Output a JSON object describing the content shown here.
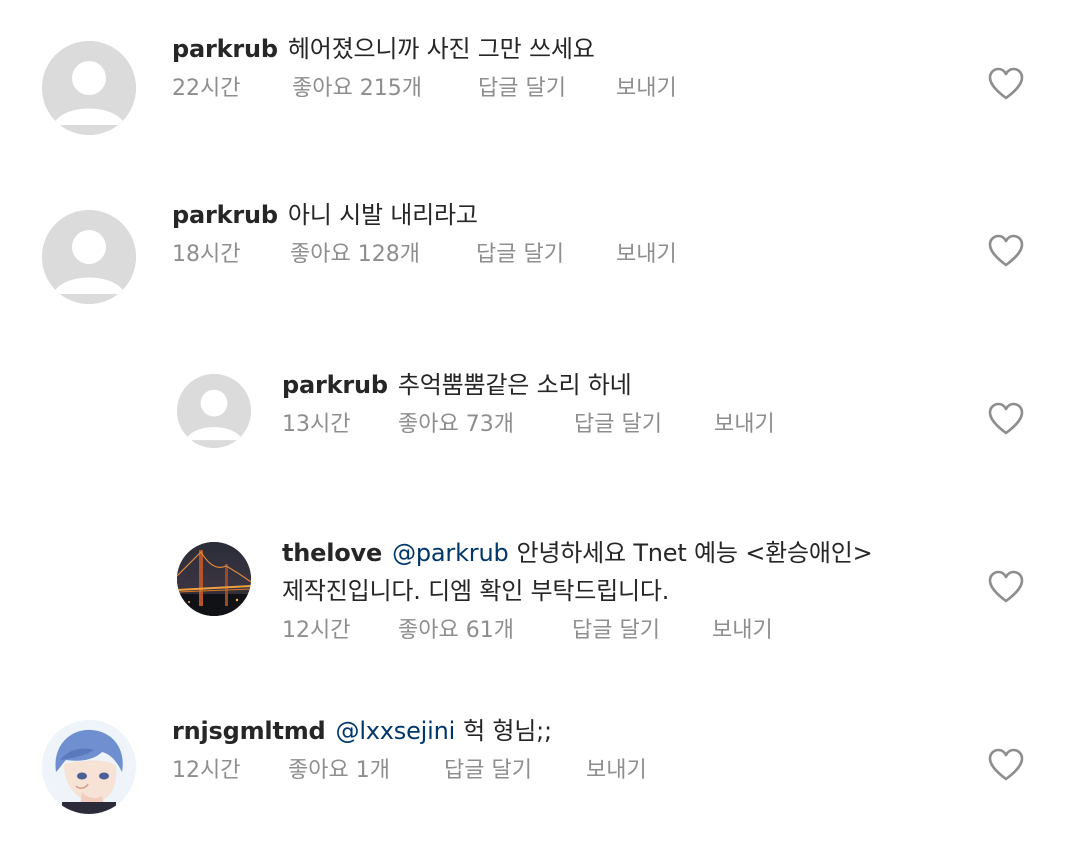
{
  "comments": [
    {
      "username": "parkrub",
      "mention": "",
      "text": "헤어졌으니까 사진 그만 쓰세요",
      "text2": "",
      "time": "22시간",
      "likes": "좋아요 215개",
      "reply_label": "답글 달기",
      "send_label": "보내기",
      "avatar": "default-avatar"
    },
    {
      "username": "parkrub",
      "mention": "",
      "text": "아니 시발 내리라고",
      "text2": "",
      "time": "18시간",
      "likes": "좋아요 128개",
      "reply_label": "답글 달기",
      "send_label": "보내기",
      "avatar": "default-avatar"
    },
    {
      "username": "parkrub",
      "mention": "",
      "text": "추억뿜뿜같은 소리 하네",
      "text2": "",
      "time": "13시간",
      "likes": "좋아요 73개",
      "reply_label": "답글 달기",
      "send_label": "보내기",
      "avatar": "default-avatar"
    },
    {
      "username": "thelove",
      "mention": "@parkrub",
      "text": "안녕하세요 Tnet 예능 <환승애인>",
      "text2": "제작진입니다. 디엠 확인 부탁드립니다.",
      "time": "12시간",
      "likes": "좋아요 61개",
      "reply_label": "답글 달기",
      "send_label": "보내기",
      "avatar": "bridge-night-photo"
    },
    {
      "username": "rnjsgmltmd",
      "mention": "@lxxsejini",
      "text": "헉 형님;;",
      "text2": "",
      "time": "12시간",
      "likes": "좋아요 1개",
      "reply_label": "답글 달기",
      "send_label": "보내기",
      "avatar": "anime-boy-illustration"
    }
  ],
  "colors": {
    "text": "#262626",
    "meta": "#8e8e8e",
    "mention": "#00376b",
    "avatar_placeholder": "#dbdbdb"
  },
  "icons": {
    "like": "heart-outline-icon"
  }
}
